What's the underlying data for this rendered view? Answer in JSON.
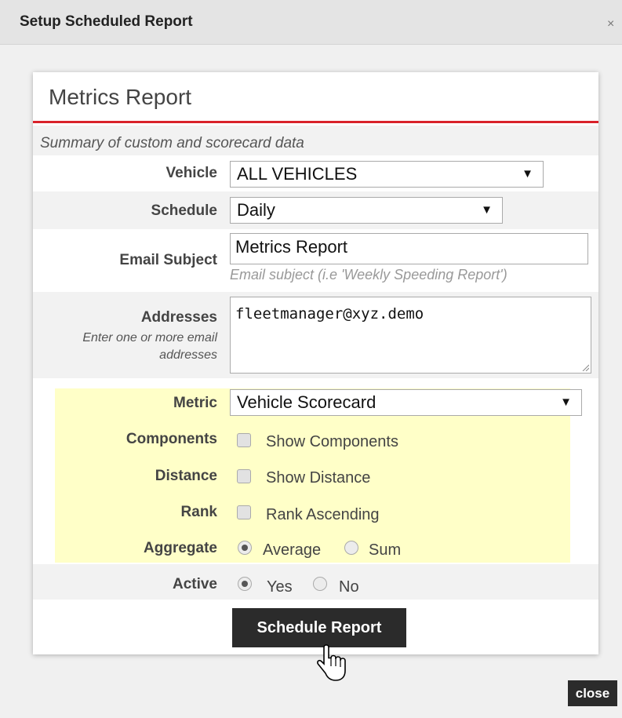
{
  "dialog": {
    "title": "Setup Scheduled Report",
    "close_x": "×",
    "close_button": "close"
  },
  "report": {
    "title": "Metrics Report",
    "description": "Summary of custom and scorecard data"
  },
  "form": {
    "vehicle": {
      "label": "Vehicle",
      "value": "ALL VEHICLES"
    },
    "schedule": {
      "label": "Schedule",
      "value": "Daily"
    },
    "email_subject": {
      "label": "Email Subject",
      "value": "Metrics Report",
      "hint": "Email subject (i.e 'Weekly Speeding Report')"
    },
    "addresses": {
      "label": "Addresses",
      "sublabel": "Enter one or more email addresses",
      "value": "fleetmanager@xyz.demo"
    },
    "metric": {
      "label": "Metric",
      "value": "Vehicle Scorecard"
    },
    "components": {
      "label": "Components",
      "option": "Show Components",
      "checked": false
    },
    "distance": {
      "label": "Distance",
      "option": "Show Distance",
      "checked": false
    },
    "rank": {
      "label": "Rank",
      "option": "Rank Ascending",
      "checked": false
    },
    "aggregate": {
      "label": "Aggregate",
      "options": [
        "Average",
        "Sum"
      ],
      "selected": "Average"
    },
    "active": {
      "label": "Active",
      "options": [
        "Yes",
        "No"
      ],
      "selected": "Yes"
    },
    "submit_label": "Schedule Report"
  },
  "colors": {
    "accent_red": "#d9222a",
    "highlight_yellow": "#ffffc8",
    "button_dark": "#2b2b2b"
  },
  "icons": {
    "dropdown": "dropdown-arrow-icon",
    "dismiss": "close-icon",
    "pointer": "hand-cursor-icon"
  }
}
